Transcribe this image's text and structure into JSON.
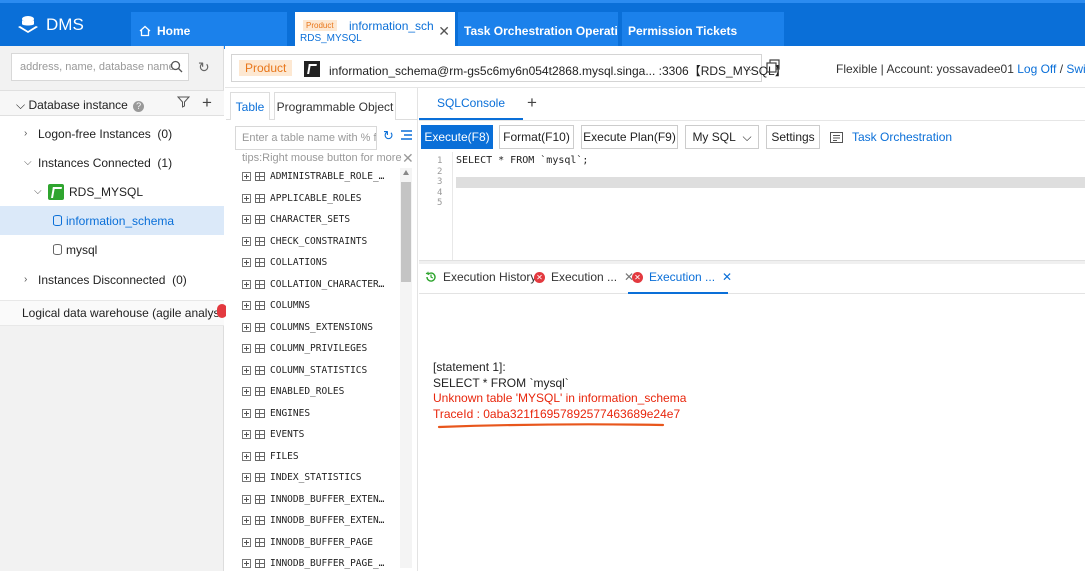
{
  "app": {
    "title": "DMS"
  },
  "tabs": {
    "home": "Home",
    "info_badge": "Product",
    "info_title": "information_schema",
    "info_subtitle": "RDS_MYSQL",
    "task": "Task Orchestration Operation",
    "permission": "Permission Tickets"
  },
  "sidebar": {
    "search_placeholder": "address, name, database name",
    "db_instance_label": "Database instance",
    "tree": {
      "logon_free": "Logon-free Instances",
      "logon_free_count": "(0)",
      "connected": "Instances Connected",
      "connected_count": "(1)",
      "instance": "RDS_MYSQL",
      "db1": "information_schema",
      "db2": "mysql",
      "disconnected": "Instances Disconnected",
      "disconnected_count": "(0)"
    },
    "logical_dw": "Logical data warehouse (agile analysis)"
  },
  "connection": {
    "product_badge": "Product",
    "text": "information_schema@rm-gs5c6my6n054t2868.mysql.singa... :3306【RDS_MYSQL】",
    "account_prefix": "Flexible | Account: yossavadee01",
    "logoff": "Log Off",
    "switch": "Switch"
  },
  "objects": {
    "tab_table": "Table",
    "tab_programmable": "Programmable Object",
    "filter_placeholder": "Enter a table name with % for fuzzy search",
    "tips": "tips:Right mouse button for more operations",
    "tables": [
      "ADMINISTRABLE_ROLE_AUTHORIZATIONS",
      "APPLICABLE_ROLES",
      "CHARACTER_SETS",
      "CHECK_CONSTRAINTS",
      "COLLATIONS",
      "COLLATION_CHARACTER_SET_APPLICABILITY",
      "COLUMNS",
      "COLUMNS_EXTENSIONS",
      "COLUMN_PRIVILEGES",
      "COLUMN_STATISTICS",
      "ENABLED_ROLES",
      "ENGINES",
      "EVENTS",
      "FILES",
      "INDEX_STATISTICS",
      "INNODB_BUFFER_EXTENTS",
      "INNODB_BUFFER_EXTENTS_LRU",
      "INNODB_BUFFER_PAGE",
      "INNODB_BUFFER_PAGE_LRU"
    ]
  },
  "console": {
    "tab": "SQLConsole",
    "toolbar": {
      "execute": "Execute(F8)",
      "format": "Format(F10)",
      "plan": "Execute Plan(F9)",
      "dialect": "My SQL",
      "settings": "Settings",
      "task": "Task Orchestration"
    },
    "line_numbers": [
      "1",
      "2",
      "3",
      "4",
      "5"
    ],
    "code": "SELECT * FROM `mysql`;"
  },
  "results": {
    "history_tab": "Execution History",
    "err_tab1": "Execution ...",
    "err_tab2": "Execution ...",
    "statement_label": "[statement 1]:",
    "statement_sql": "SELECT * FROM `mysql`",
    "error_message": "Unknown table 'MYSQL' in information_schema",
    "trace_id": "TraceId : 0aba321f16957892577463689e24e7"
  },
  "colors": {
    "topbar": "#0a6fd8",
    "accent": "#0a6fd8",
    "error": "#e8260c",
    "product_badge_bg": "#fde8d2",
    "product_badge_fg": "#e8761a",
    "rds_icon": "#2fa52f"
  }
}
